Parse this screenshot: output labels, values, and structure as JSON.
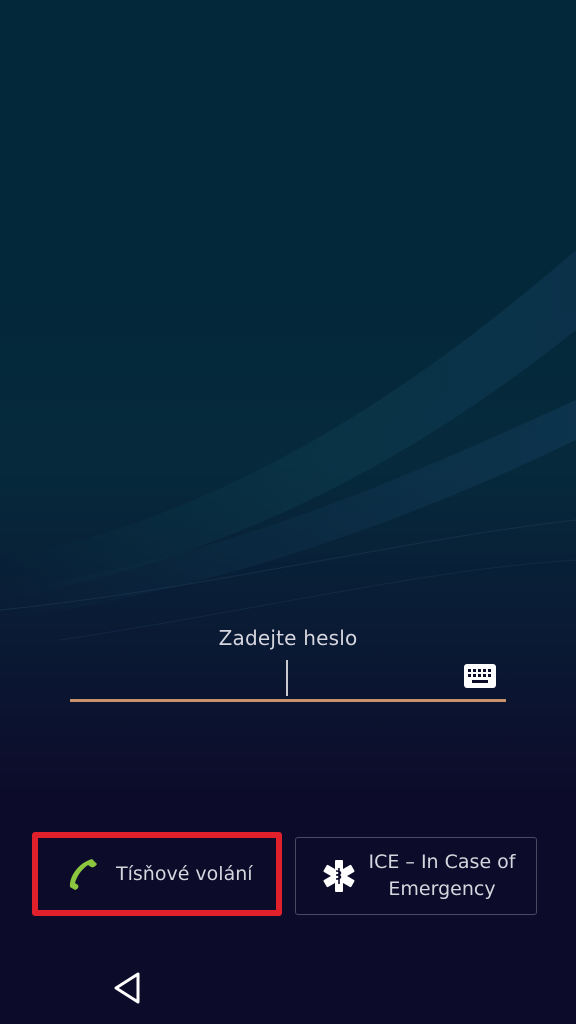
{
  "lockscreen": {
    "prompt": "Zadejte heslo",
    "password_value": ""
  },
  "buttons": {
    "emergency_call_label": "Tísňové volání",
    "ice_label_line1": "ICE – In Case of",
    "ice_label_line2": "Emergency"
  },
  "icons": {
    "keyboard": "keyboard-icon",
    "phone": "phone-icon",
    "ice": "medical-star-icon",
    "back": "back-icon"
  },
  "colors": {
    "underline": "#c8936a",
    "highlight_border": "#e0202a",
    "phone_icon": "#8cc63f"
  }
}
